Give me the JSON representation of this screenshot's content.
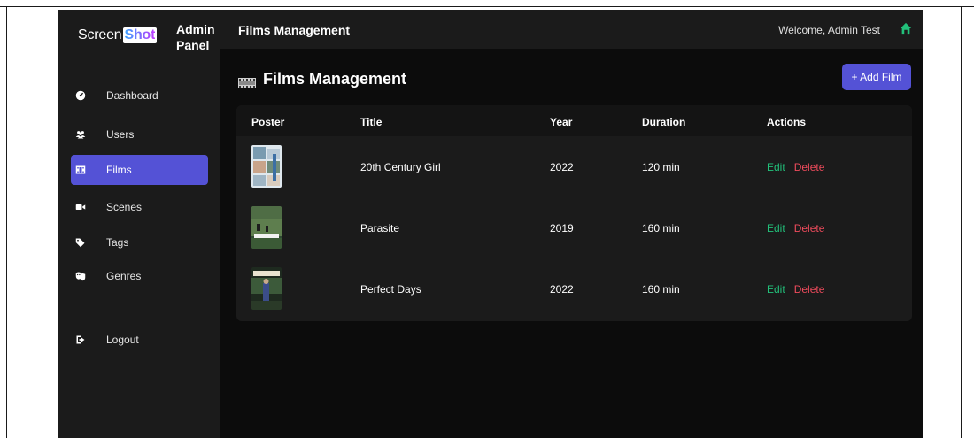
{
  "sidebar": {
    "brand_prefix": "Screen",
    "brand_suffix": "Shot",
    "panel_title_line1": "Admin",
    "panel_title_line2": "Panel",
    "items": [
      {
        "label": "Dashboard",
        "icon": "dashboard-icon",
        "active": false
      },
      {
        "label": "Users",
        "icon": "users-icon",
        "active": false
      },
      {
        "label": "Films",
        "icon": "film-icon",
        "active": true
      },
      {
        "label": "Scenes",
        "icon": "video-camera-icon",
        "active": false
      },
      {
        "label": "Tags",
        "icon": "tags-icon",
        "active": false
      },
      {
        "label": "Genres",
        "icon": "masks-icon",
        "active": false
      }
    ],
    "logout_label": "Logout"
  },
  "topbar": {
    "title": "Films Management",
    "welcome": "Welcome, Admin Test"
  },
  "page": {
    "title": "Films Management",
    "add_button": "+ Add Film"
  },
  "table": {
    "headers": [
      "Poster",
      "Title",
      "Year",
      "Duration",
      "Actions"
    ],
    "rows": [
      {
        "title": "20th Century Girl",
        "year": "2022",
        "duration": "120 min",
        "edit": "Edit",
        "delete": "Delete"
      },
      {
        "title": "Parasite",
        "year": "2019",
        "duration": "160 min",
        "edit": "Edit",
        "delete": "Delete"
      },
      {
        "title": "Perfect Days",
        "year": "2022",
        "duration": "160 min",
        "edit": "Edit",
        "delete": "Delete"
      }
    ]
  },
  "colors": {
    "accent": "#5452d6",
    "sidebar_bg": "#1b1b1b",
    "main_bg": "#0c0c0c",
    "edit": "#22c07a",
    "delete": "#ef4b5c"
  }
}
